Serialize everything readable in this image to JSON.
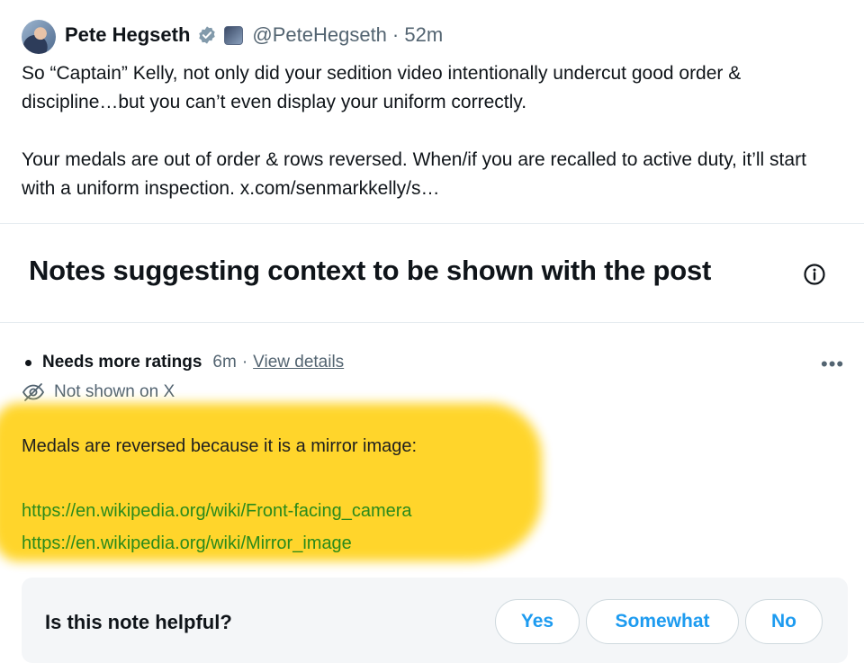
{
  "post": {
    "author_name": "Pete Hegseth",
    "handle": "@PeteHegseth",
    "time": "· 52m",
    "paragraphs": [
      "So “Captain” Kelly, not only did your sedition video intentionally undercut good order & discipline…but you can’t even display your uniform correctly.",
      "Your medals are out of order & rows reversed. When/if you are recalled to active duty, it’ll start with a uniform inspection. x.com/senmarkkelly/s…"
    ]
  },
  "notes": {
    "header": "Notes suggesting context to be shown with the post",
    "icons": {
      "info": "info-icon",
      "more": "more-icon",
      "visibility": "eye-off-icon",
      "badge": "verified-badge-icon"
    },
    "note": {
      "status": "Needs more ratings",
      "time": "6m",
      "separator": "·",
      "view_details": "View details",
      "visibility": "Not shown on X",
      "text": "Medals are reversed because it is a mirror image:",
      "links": [
        "https://en.wikipedia.org/wiki/Front-facing_camera",
        "https://en.wikipedia.org/wiki/Mirror_image"
      ]
    },
    "helpful": {
      "question": "Is this note helpful?",
      "yes": "Yes",
      "somewhat": "Somewhat",
      "no": "No"
    }
  },
  "colors": {
    "accent": "#1d9bf0",
    "highlight": "#ffd21a",
    "link": "#2a8a1b"
  }
}
